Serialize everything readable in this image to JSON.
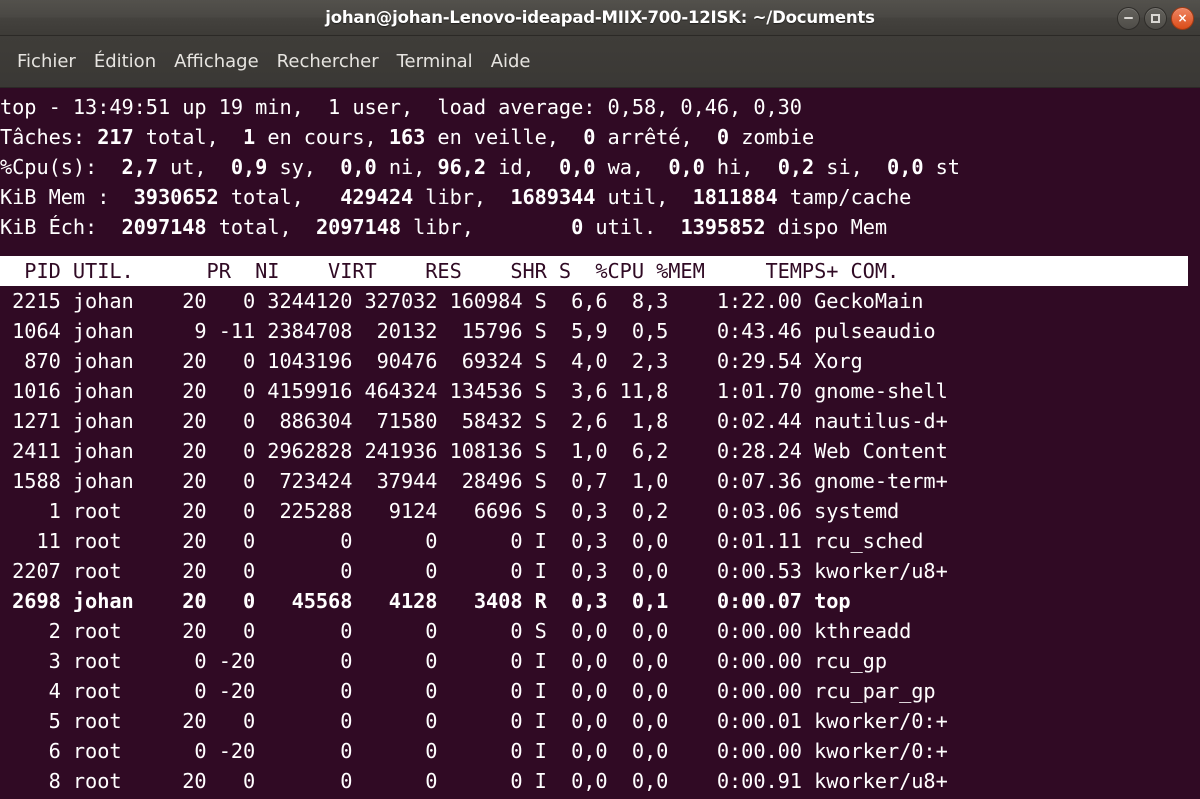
{
  "window": {
    "title": "johan@johan-Lenovo-ideapad-MIIX-700-12ISK: ~/Documents",
    "controls": {
      "minimize_label": "–",
      "maximize_label": "□",
      "close_label": "×"
    }
  },
  "menubar": {
    "items": [
      {
        "label": "Fichier"
      },
      {
        "label": "Édition"
      },
      {
        "label": "Affichage"
      },
      {
        "label": "Rechercher"
      },
      {
        "label": "Terminal"
      },
      {
        "label": "Aide"
      }
    ]
  },
  "terminal": {
    "background_color": "#300a24",
    "foreground_color": "#ffffff",
    "summary": {
      "uptime_line": {
        "prefix": "top - ",
        "time": "13:49:51",
        "up_text": " up ",
        "uptime": "19 min",
        "users_text": ",  1 user,  load average: ",
        "load_average": "0,58, 0,46, 0,30",
        "full": "top - 13:49:51 up 19 min,  1 user,  load average: 0,58, 0,46, 0,30"
      },
      "tasks_line": {
        "label": "Tâches: ",
        "total": "217",
        "total_label": " total,  ",
        "running": "1",
        "running_label": " en cours, ",
        "sleeping": "163",
        "sleeping_label": " en veille,  ",
        "stopped": "0",
        "stopped_label": " arrêté,  ",
        "zombie": "0",
        "zombie_label": " zombie"
      },
      "cpu_line": {
        "label": "%Cpu(s):  ",
        "us": "2,7",
        "us_label": " ut,  ",
        "sy": "0,9",
        "sy_label": " sy,  ",
        "ni": "0,0",
        "ni_label": " ni, ",
        "id": "96,2",
        "id_label": " id,  ",
        "wa": "0,0",
        "wa_label": " wa,  ",
        "hi": "0,0",
        "hi_label": " hi,  ",
        "si": "0,2",
        "si_label": " si,  ",
        "st": "0,0",
        "st_label": " st"
      },
      "mem_line": {
        "label": "KiB Mem :  ",
        "total": "3930652",
        "total_label": " total,   ",
        "free": "429424",
        "free_label": " libr,  ",
        "used": "1689344",
        "used_label": " util,  ",
        "buff_cache": "1811884",
        "buff_cache_label": " tamp/cache"
      },
      "swap_line": {
        "label": "KiB Éch:  ",
        "total": "2097148",
        "total_label": " total,  ",
        "free": "2097148",
        "free_label": " libr,        ",
        "used": "0",
        "used_label": " util.  ",
        "avail": "1395852",
        "avail_label": " dispo Mem"
      }
    },
    "table": {
      "headers": [
        "PID",
        "UTIL.",
        "PR",
        "NI",
        "VIRT",
        "RES",
        "SHR",
        "S",
        "%CPU",
        "%MEM",
        "TEMPS+",
        "COM."
      ],
      "header_line": "  PID UTIL.      PR  NI    VIRT    RES    SHR S  %CPU %MEM     TEMPS+ COM.",
      "rows": [
        {
          "pid": "2215",
          "user": "johan",
          "pr": "20",
          "ni": "0",
          "virt": "3244120",
          "res": "327032",
          "shr": "160984",
          "s": "S",
          "cpu": "6,6",
          "mem": "8,3",
          "time": "1:22.00",
          "command": "GeckoMain",
          "bold": false
        },
        {
          "pid": "1064",
          "user": "johan",
          "pr": "9",
          "ni": "-11",
          "virt": "2384708",
          "res": "20132",
          "shr": "15796",
          "s": "S",
          "cpu": "5,9",
          "mem": "0,5",
          "time": "0:43.46",
          "command": "pulseaudio",
          "bold": false
        },
        {
          "pid": "870",
          "user": "johan",
          "pr": "20",
          "ni": "0",
          "virt": "1043196",
          "res": "90476",
          "shr": "69324",
          "s": "S",
          "cpu": "4,0",
          "mem": "2,3",
          "time": "0:29.54",
          "command": "Xorg",
          "bold": false
        },
        {
          "pid": "1016",
          "user": "johan",
          "pr": "20",
          "ni": "0",
          "virt": "4159916",
          "res": "464324",
          "shr": "134536",
          "s": "S",
          "cpu": "3,6",
          "mem": "11,8",
          "time": "1:01.70",
          "command": "gnome-shell",
          "bold": false
        },
        {
          "pid": "1271",
          "user": "johan",
          "pr": "20",
          "ni": "0",
          "virt": "886304",
          "res": "71580",
          "shr": "58432",
          "s": "S",
          "cpu": "2,6",
          "mem": "1,8",
          "time": "0:02.44",
          "command": "nautilus-d+",
          "bold": false
        },
        {
          "pid": "2411",
          "user": "johan",
          "pr": "20",
          "ni": "0",
          "virt": "2962828",
          "res": "241936",
          "shr": "108136",
          "s": "S",
          "cpu": "1,0",
          "mem": "6,2",
          "time": "0:28.24",
          "command": "Web Content",
          "bold": false
        },
        {
          "pid": "1588",
          "user": "johan",
          "pr": "20",
          "ni": "0",
          "virt": "723424",
          "res": "37944",
          "shr": "28496",
          "s": "S",
          "cpu": "0,7",
          "mem": "1,0",
          "time": "0:07.36",
          "command": "gnome-term+",
          "bold": false
        },
        {
          "pid": "1",
          "user": "root",
          "pr": "20",
          "ni": "0",
          "virt": "225288",
          "res": "9124",
          "shr": "6696",
          "s": "S",
          "cpu": "0,3",
          "mem": "0,2",
          "time": "0:03.06",
          "command": "systemd",
          "bold": false
        },
        {
          "pid": "11",
          "user": "root",
          "pr": "20",
          "ni": "0",
          "virt": "0",
          "res": "0",
          "shr": "0",
          "s": "I",
          "cpu": "0,3",
          "mem": "0,0",
          "time": "0:01.11",
          "command": "rcu_sched",
          "bold": false
        },
        {
          "pid": "2207",
          "user": "root",
          "pr": "20",
          "ni": "0",
          "virt": "0",
          "res": "0",
          "shr": "0",
          "s": "I",
          "cpu": "0,3",
          "mem": "0,0",
          "time": "0:00.53",
          "command": "kworker/u8+",
          "bold": false
        },
        {
          "pid": "2698",
          "user": "johan",
          "pr": "20",
          "ni": "0",
          "virt": "45568",
          "res": "4128",
          "shr": "3408",
          "s": "R",
          "cpu": "0,3",
          "mem": "0,1",
          "time": "0:00.07",
          "command": "top",
          "bold": true
        },
        {
          "pid": "2",
          "user": "root",
          "pr": "20",
          "ni": "0",
          "virt": "0",
          "res": "0",
          "shr": "0",
          "s": "S",
          "cpu": "0,0",
          "mem": "0,0",
          "time": "0:00.00",
          "command": "kthreadd",
          "bold": false
        },
        {
          "pid": "3",
          "user": "root",
          "pr": "0",
          "ni": "-20",
          "virt": "0",
          "res": "0",
          "shr": "0",
          "s": "I",
          "cpu": "0,0",
          "mem": "0,0",
          "time": "0:00.00",
          "command": "rcu_gp",
          "bold": false
        },
        {
          "pid": "4",
          "user": "root",
          "pr": "0",
          "ni": "-20",
          "virt": "0",
          "res": "0",
          "shr": "0",
          "s": "I",
          "cpu": "0,0",
          "mem": "0,0",
          "time": "0:00.00",
          "command": "rcu_par_gp",
          "bold": false
        },
        {
          "pid": "5",
          "user": "root",
          "pr": "20",
          "ni": "0",
          "virt": "0",
          "res": "0",
          "shr": "0",
          "s": "I",
          "cpu": "0,0",
          "mem": "0,0",
          "time": "0:00.01",
          "command": "kworker/0:+",
          "bold": false
        },
        {
          "pid": "6",
          "user": "root",
          "pr": "0",
          "ni": "-20",
          "virt": "0",
          "res": "0",
          "shr": "0",
          "s": "I",
          "cpu": "0,0",
          "mem": "0,0",
          "time": "0:00.00",
          "command": "kworker/0:+",
          "bold": false
        },
        {
          "pid": "8",
          "user": "root",
          "pr": "20",
          "ni": "0",
          "virt": "0",
          "res": "0",
          "shr": "0",
          "s": "I",
          "cpu": "0,0",
          "mem": "0,0",
          "time": "0:00.91",
          "command": "kworker/u8+",
          "bold": false
        }
      ]
    }
  }
}
